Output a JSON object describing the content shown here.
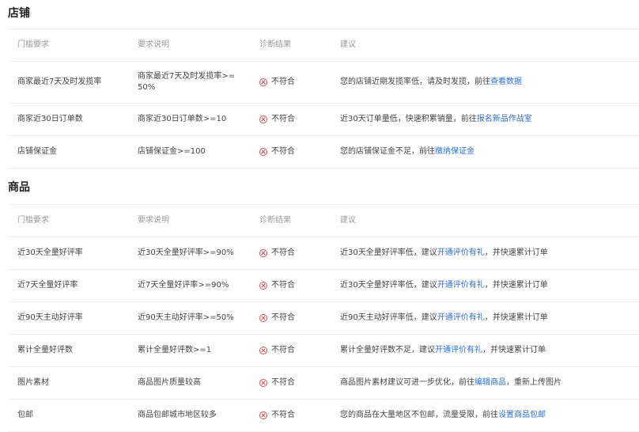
{
  "shop": {
    "title": "店铺",
    "headers": [
      "门槛要求",
      "要求说明",
      "诊断结果",
      "建议"
    ],
    "rows": [
      {
        "req": "商家最近7天及时发揽率",
        "desc": "商家最近7天及时发揽率>=\n50%",
        "result": "不符合",
        "advice_text": "您的店铺近期发揽率低，请及时发揽，前往",
        "advice_link": "查看数据",
        "advice_after": ""
      },
      {
        "req": "商家近30日订单数",
        "desc": "商家近30日订单数>=10",
        "result": "不符合",
        "advice_text": "近30天订单量低，快速积累销量，前往",
        "advice_link": "报名新品作战室",
        "advice_after": ""
      },
      {
        "req": "店铺保证金",
        "desc": "店铺保证金>=100",
        "result": "不符合",
        "advice_text": "您的店铺保证金不足，前往",
        "advice_link": "缴纳保证金",
        "advice_after": ""
      }
    ]
  },
  "goods": {
    "title": "商品",
    "headers": [
      "门槛要求",
      "要求说明",
      "诊断结果",
      "建议"
    ],
    "rows": [
      {
        "req": "近30天全量好评率",
        "desc": "近30天全量好评率>=90%",
        "result": "不符合",
        "advice_text": "近30天全量好评率低，建议",
        "advice_link": "开通评价有礼",
        "advice_after": "，并快速累计订单"
      },
      {
        "req": "近7天全量好评率",
        "desc": "近7天全量好评率>=90%",
        "result": "不符合",
        "advice_text": "近30天全量好评率低，建议",
        "advice_link": "开通评价有礼",
        "advice_after": "，并快速累计订单"
      },
      {
        "req": "近90天主动好评率",
        "desc": "近90天主动好评率>=50%",
        "result": "不符合",
        "advice_text": "近90天主动好评率低，建议",
        "advice_link": "开通评价有礼",
        "advice_after": "，并快速累计订单"
      },
      {
        "req": "累计全量好评数",
        "desc": "累计全量好评数>=1",
        "result": "不符合",
        "advice_text": "累计全量好评数不足，建议",
        "advice_link": "开通评价有礼",
        "advice_after": "，并快速累计订单"
      },
      {
        "req": "图片素材",
        "desc": "商品图片质量较高",
        "result": "不符合",
        "advice_text": "商品图片素材建议可进一步优化，前往",
        "advice_link": "编辑商品",
        "advice_after": "，重新上传图片"
      },
      {
        "req": "包邮",
        "desc": "商品包邮城市地区较多",
        "result": "不符合",
        "advice_text": "您的商品在大量地区不包邮，流量受限，前往",
        "advice_link": "设置商品包邮",
        "advice_after": ""
      }
    ]
  },
  "colors": {
    "fail": "#e34b4b",
    "link": "#2d6fe0"
  },
  "icons": {
    "fail": "close-circle-icon"
  }
}
